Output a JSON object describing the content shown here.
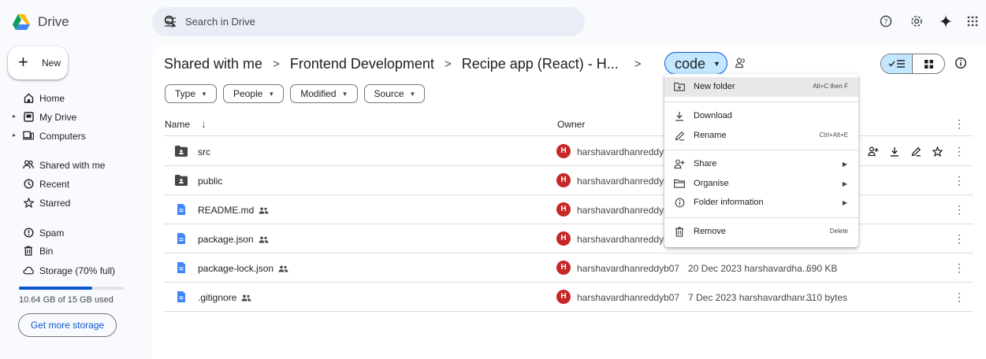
{
  "app": {
    "name": "Drive"
  },
  "search": {
    "placeholder": "Search in Drive"
  },
  "sidebar": {
    "new_label": "New",
    "items": [
      {
        "label": "Home",
        "icon": "home-icon"
      },
      {
        "label": "My Drive",
        "icon": "drive-icon"
      },
      {
        "label": "Computers",
        "icon": "computer-icon"
      },
      {
        "label": "Shared with me",
        "icon": "people-icon"
      },
      {
        "label": "Recent",
        "icon": "clock-icon"
      },
      {
        "label": "Starred",
        "icon": "star-icon"
      },
      {
        "label": "Spam",
        "icon": "spam-icon"
      },
      {
        "label": "Bin",
        "icon": "bin-icon"
      },
      {
        "label": "Storage (70% full)",
        "icon": "cloud-icon"
      }
    ],
    "storage_used_fraction": 0.7,
    "storage_text": "10.64 GB of 15 GB used",
    "get_storage_label": "Get more storage"
  },
  "breadcrumb": {
    "items": [
      "Shared with me",
      "Frontend Development",
      "Recipe app (React) - H..."
    ],
    "current": "code"
  },
  "filters": [
    "Type",
    "People",
    "Modified",
    "Source"
  ],
  "table": {
    "headers": {
      "name": "Name",
      "owner": "Owner"
    },
    "rows": [
      {
        "name": "src",
        "type": "folder",
        "shared": false,
        "owner": "harshavardhanreddyb07",
        "modified": "",
        "size": ""
      },
      {
        "name": "public",
        "type": "folder",
        "shared": false,
        "owner": "harshavardhanreddyb07",
        "modified": "",
        "size": ""
      },
      {
        "name": "README.md",
        "type": "doc",
        "shared": true,
        "owner": "harshavardhanreddyb07",
        "modified": "",
        "size": ""
      },
      {
        "name": "package.json",
        "type": "doc",
        "shared": true,
        "owner": "harshavardhanreddyb07",
        "modified": "",
        "size": ""
      },
      {
        "name": "package-lock.json",
        "type": "doc",
        "shared": true,
        "owner": "harshavardhanreddyb07",
        "modified": "20 Dec 2023 harshavardha...",
        "size": "690 KB"
      },
      {
        "name": ".gitignore",
        "type": "doc",
        "shared": true,
        "owner": "harshavardhanreddyb07",
        "modified": "7 Dec 2023 harshavardhanr...",
        "size": "310 bytes"
      }
    ],
    "owner_initial": "H"
  },
  "context_menu": {
    "items": [
      {
        "label": "New folder",
        "shortcut": "Alt+C then F"
      },
      {
        "label": "Download",
        "shortcut": ""
      },
      {
        "label": "Rename",
        "shortcut": "Ctrl+Alt+E"
      },
      {
        "label": "Share",
        "shortcut": ""
      },
      {
        "label": "Organise",
        "shortcut": ""
      },
      {
        "label": "Folder information",
        "shortcut": ""
      },
      {
        "label": "Remove",
        "shortcut": "Delete"
      }
    ]
  },
  "colors": {
    "accent": "#0b57d0",
    "selected_chip": "#c2e7ff",
    "avatar": "#c62828",
    "doc_icon": "#4285f4",
    "folder_icon": "#444746"
  }
}
